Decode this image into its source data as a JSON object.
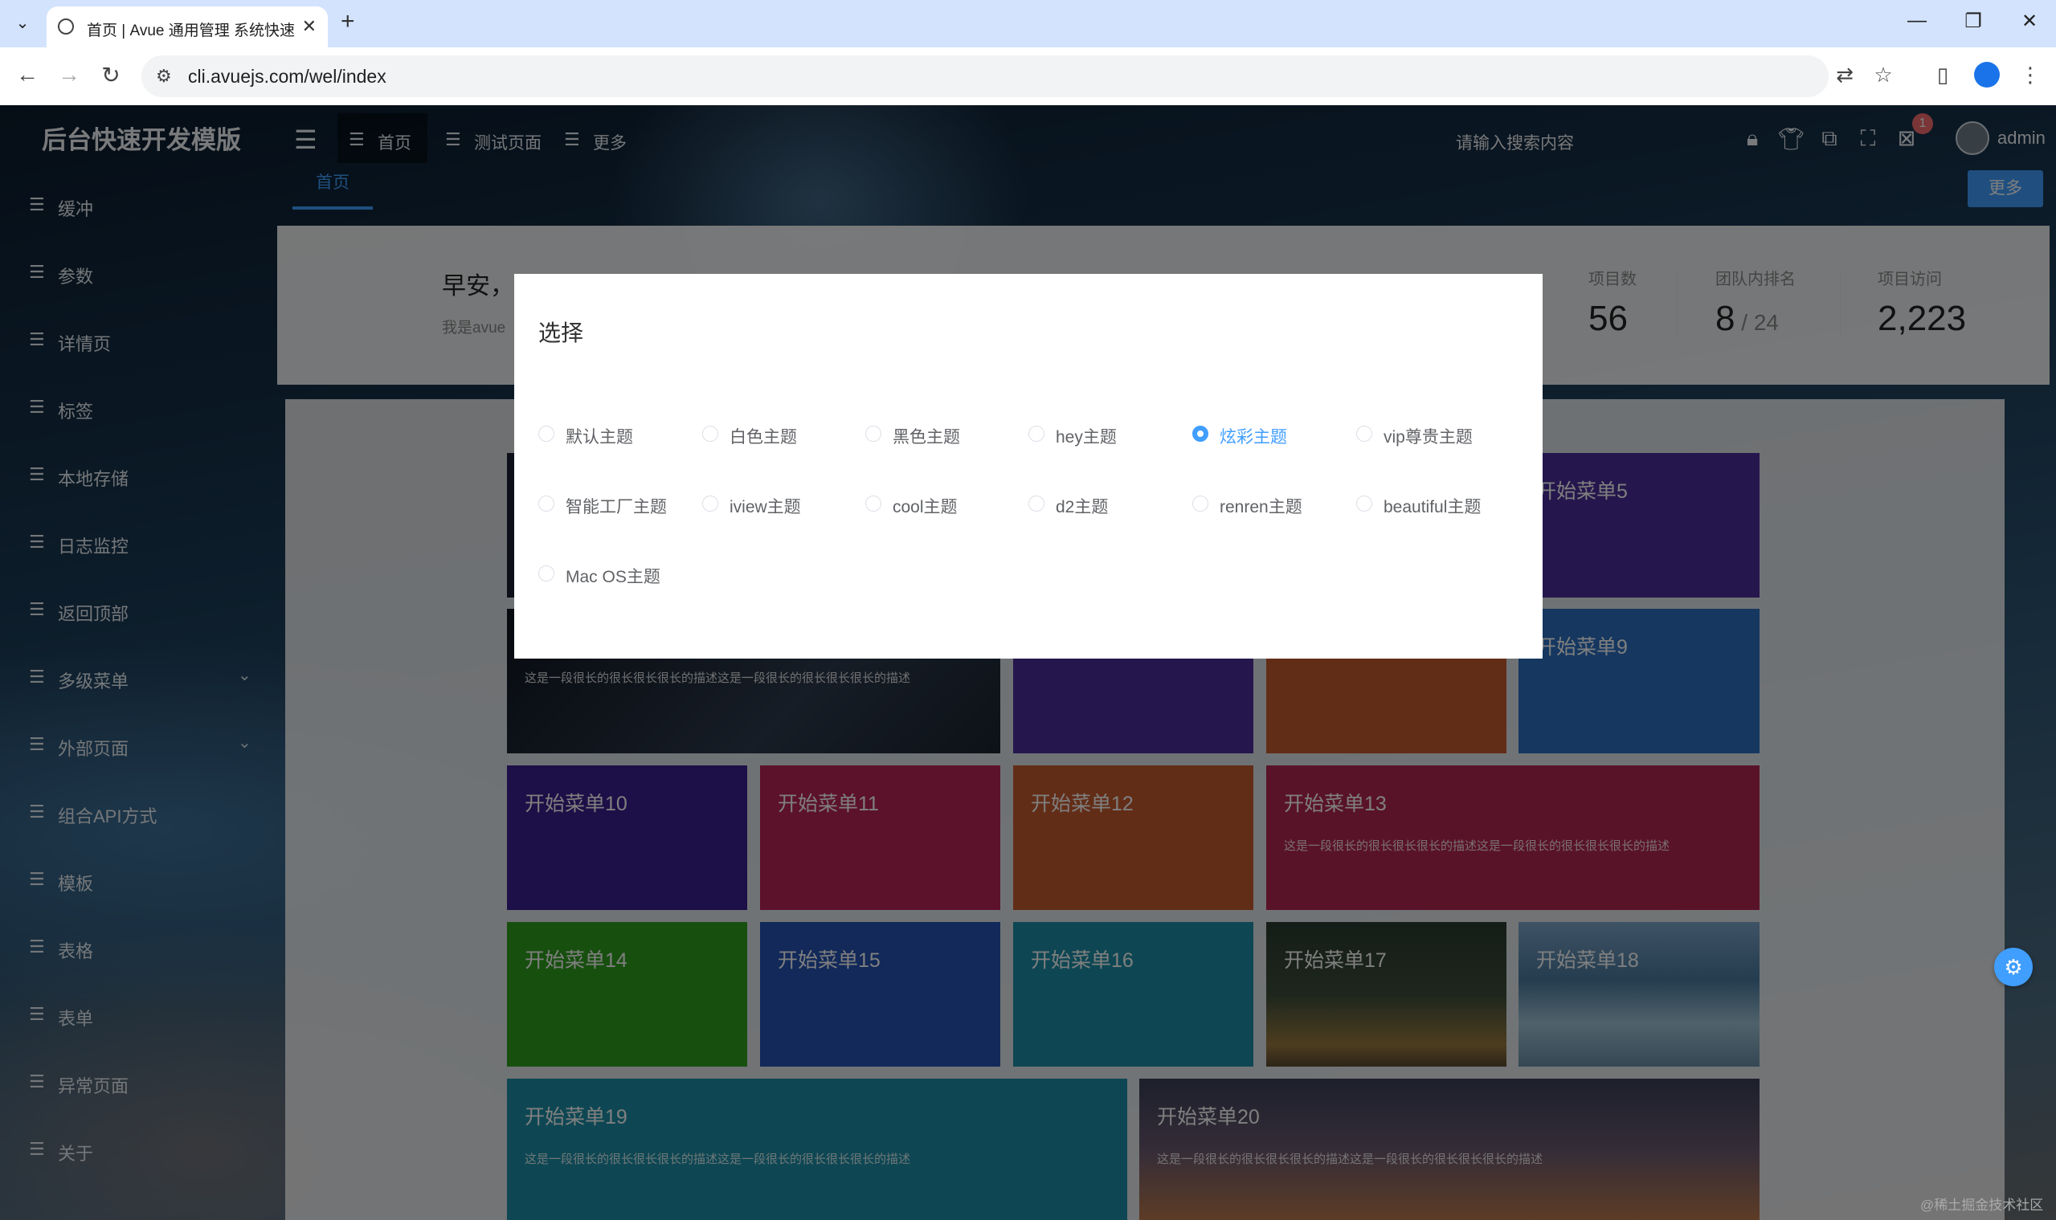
{
  "browser": {
    "tab_title": "首页 | Avue 通用管理 系统快速",
    "url": "cli.avuejs.com/wel/index"
  },
  "app": {
    "logo": "后台快速开发模版",
    "sidebar": [
      {
        "label": "缓冲",
        "expandable": false
      },
      {
        "label": "参数",
        "expandable": false
      },
      {
        "label": "详情页",
        "expandable": false
      },
      {
        "label": "标签",
        "expandable": false
      },
      {
        "label": "本地存储",
        "expandable": false
      },
      {
        "label": "日志监控",
        "expandable": false
      },
      {
        "label": "返回顶部",
        "expandable": false
      },
      {
        "label": "多级菜单",
        "expandable": true
      },
      {
        "label": "外部页面",
        "expandable": true
      },
      {
        "label": "组合API方式",
        "expandable": false
      },
      {
        "label": "模板",
        "expandable": false
      },
      {
        "label": "表格",
        "expandable": false
      },
      {
        "label": "表单",
        "expandable": false
      },
      {
        "label": "异常页面",
        "expandable": false
      },
      {
        "label": "关于",
        "expandable": false
      }
    ],
    "topnav": [
      {
        "label": "首页"
      },
      {
        "label": "测试页面"
      },
      {
        "label": "更多"
      }
    ],
    "search_placeholder": "请输入搜索内容",
    "notification_count": "1",
    "user_name": "admin",
    "tag_active": "首页",
    "more_button": "更多"
  },
  "welcome": {
    "greeting": "早安，",
    "intro": "我是avue",
    "stats": [
      {
        "title": "项目数",
        "value": "56",
        "suffix": ""
      },
      {
        "title": "团队内排名",
        "value": "8",
        "suffix": " / 24"
      },
      {
        "title": "项目访问",
        "value": "2,223",
        "suffix": ""
      }
    ]
  },
  "tiles": {
    "t5": "开始菜单5",
    "t9": "开始菜单9",
    "t10": "开始菜单10",
    "t11": "开始菜单11",
    "t12": "开始菜单12",
    "t13": "开始菜单13",
    "t14": "开始菜单14",
    "t15": "开始菜单15",
    "t16": "开始菜单16",
    "t17": "开始菜单17",
    "t18": "开始菜单18",
    "t19": "开始菜单19",
    "t20": "开始菜单20",
    "desc_long": "这是一段很长的很长很长很长的描述这是一段很长的很长很长很长的描述",
    "desc_short": "这是一段很长的很长很长很长的描述这是一段很长的很长很长很长的描述"
  },
  "modal": {
    "title": "选择",
    "options": [
      {
        "label": "默认主题",
        "checked": false
      },
      {
        "label": "白色主题",
        "checked": false
      },
      {
        "label": "黑色主题",
        "checked": false
      },
      {
        "label": "hey主题",
        "checked": false
      },
      {
        "label": "炫彩主题",
        "checked": true
      },
      {
        "label": "vip尊贵主题",
        "checked": false
      },
      {
        "label": "智能工厂主题",
        "checked": false
      },
      {
        "label": "iview主题",
        "checked": false
      },
      {
        "label": "cool主题",
        "checked": false
      },
      {
        "label": "d2主题",
        "checked": false
      },
      {
        "label": "renren主题",
        "checked": false
      },
      {
        "label": "beautiful主题",
        "checked": false
      },
      {
        "label": "Mac OS主题",
        "checked": false
      }
    ]
  },
  "watermark": "@稀土掘金技术社区",
  "colors": {
    "accent": "#409eff",
    "tile_purple": "#4a2f9a",
    "tile_pink": "#b82457",
    "tile_orange": "#c55a2f",
    "tile_crimson": "#b32650",
    "tile_green": "#2f9e1e",
    "tile_blue": "#2453b3",
    "tile_teal": "#1d8fa6"
  }
}
